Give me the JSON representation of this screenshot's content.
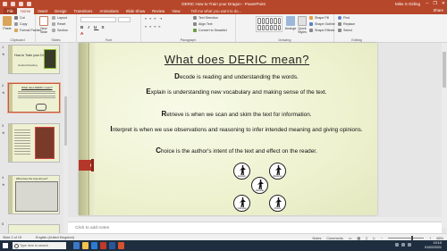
{
  "window": {
    "title": "DERIC How to Train your Dragon - PowerPoint",
    "user": "Mike S Girling",
    "share": "Share",
    "min": "–",
    "max": "❐",
    "close": "✕"
  },
  "tabs": [
    "File",
    "Home",
    "Insert",
    "Design",
    "Transitions",
    "Animations",
    "Slide Show",
    "Review",
    "View"
  ],
  "tell_me": "Tell me what you want to do...",
  "ribbon": {
    "clipboard": {
      "label": "Clipboard",
      "paste": "Paste",
      "cut": "Cut",
      "copy": "Copy",
      "format_painter": "Format Painter"
    },
    "slides": {
      "label": "Slides",
      "new_slide": "New Slide",
      "layout": "Layout",
      "reset": "Reset",
      "section": "Section"
    },
    "font": {
      "label": "Font"
    },
    "paragraph": {
      "label": "Paragraph",
      "text_direction": "Text Direction",
      "align_text": "Align Text",
      "convert": "Convert to SmartArt"
    },
    "drawing": {
      "label": "Drawing",
      "arrange": "Arrange",
      "quick_styles": "Quick Styles",
      "shape_fill": "Shape Fill",
      "shape_outline": "Shape Outline",
      "shape_effects": "Shape Effects"
    },
    "editing": {
      "label": "Editing",
      "find": "Find",
      "replace": "Replace",
      "select": "Select"
    }
  },
  "thumbnails": [
    {
      "number": "1",
      "title": "How to Train your Dragon",
      "subtitle": "Guided Reading"
    },
    {
      "number": "2",
      "title": "What does DERIC mean?"
    },
    {
      "number": "3",
      "title": "Book Cover Dragon"
    },
    {
      "number": "4",
      "title": "What does the map tell you?"
    },
    {
      "number": "5",
      "title": ""
    }
  ],
  "slide": {
    "title": "What does DERIC mean?",
    "lines": [
      {
        "initial": "D",
        "text": "ecode is reading and understanding the words."
      },
      {
        "initial": "E",
        "text": "xplain is understanding new vocabulary and making sense of the text."
      },
      {
        "initial": "R",
        "text": "etrieve is when we scan and skim the text for information."
      },
      {
        "initial": "I",
        "text": "nterpret is when we use observations and reasoning to infer intended meaning and giving opinions."
      },
      {
        "initial": "C",
        "text": "hoice is the author's intent of the text and effect on the reader."
      }
    ],
    "icons": [
      "Explain",
      "Retrieve",
      "Decode",
      "Interpret",
      "Choice"
    ]
  },
  "notes_placeholder": "Click to add notes",
  "status": {
    "slide": "Slide 2 of 19",
    "language": "English (United Kingdom)",
    "notes": "Notes",
    "comments": "Comments",
    "zoom": "66%"
  },
  "taskbar": {
    "search": "Type here to search",
    "time": "19:10",
    "date": "01/02/2021"
  },
  "colors": {
    "accent": "#b7472a",
    "slide_bg": "#eef2cf",
    "tag": "#b5372a"
  }
}
